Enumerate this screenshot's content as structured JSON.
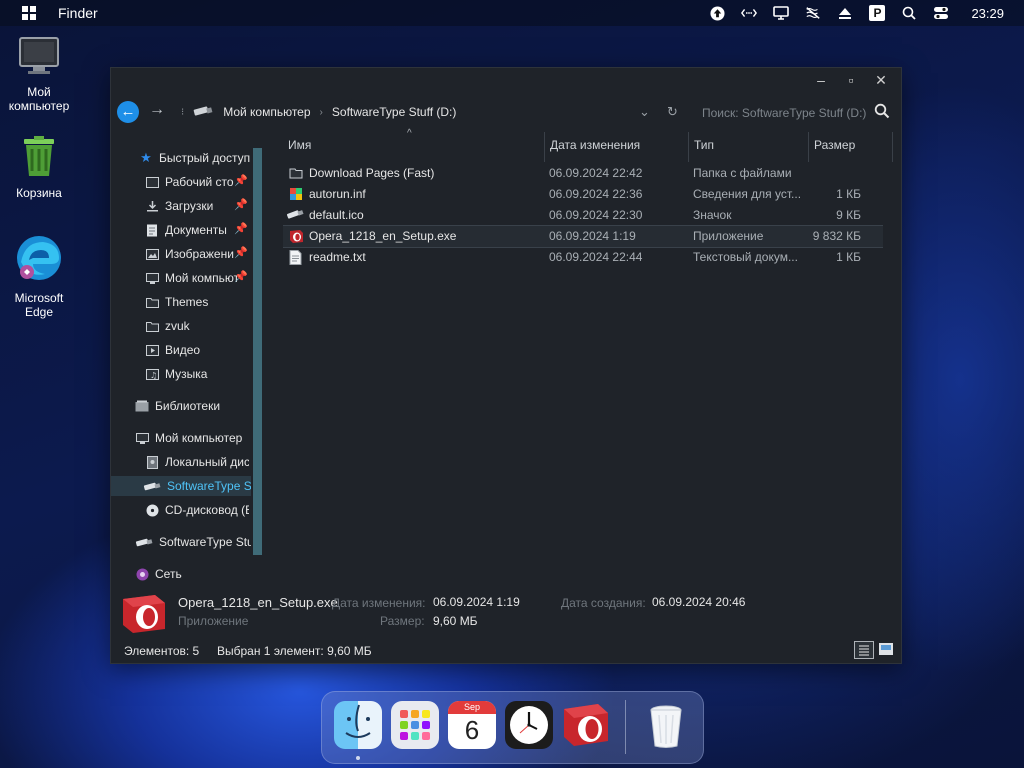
{
  "menubar": {
    "app_name": "Finder",
    "clock": "23:29",
    "tray_icons": [
      "upload-icon",
      "network-icon",
      "monitor-icon",
      "no-sound-icon",
      "eject-icon",
      "parking-icon",
      "search-icon",
      "toggle-icon"
    ],
    "parking_label": "P"
  },
  "desktop": {
    "icons": [
      {
        "label": "Мой компьютер",
        "icon": "computer-icon"
      },
      {
        "label": "Корзина",
        "icon": "recycle-bin-icon"
      },
      {
        "label": "Microsoft Edge",
        "icon": "edge-icon"
      }
    ]
  },
  "window": {
    "controls": {
      "minimize": "–",
      "maximize": "▫",
      "close": "✕"
    },
    "address": {
      "crumbs": [
        "Мой компьютер",
        "SoftwareType Stuff (D:)"
      ],
      "search_placeholder": "Поиск: SoftwareType Stuff (D:)"
    },
    "sidebar": {
      "quick_access": "Быстрый доступ",
      "quick_items": [
        "Рабочий сто",
        "Загрузки",
        "Документы",
        "Изображени",
        "Мой компьют",
        "Themes",
        "zvuk",
        "Видео",
        "Музыка"
      ],
      "libraries": "Библиотеки",
      "computer": "Мой компьютер",
      "computer_items": [
        "Локальный дис",
        "SoftwareType Stuf",
        "CD-дисковод (E"
      ],
      "drive": "SoftwareType Stuf",
      "network": "Сеть"
    },
    "columns": {
      "name": "Имя",
      "date": "Дата изменения",
      "type": "Тип",
      "size": "Размер"
    },
    "files": [
      {
        "name": "Download Pages (Fast)",
        "date": "06.09.2024 22:42",
        "type": "Папка с файлами",
        "size": "",
        "icon": "folder-icon"
      },
      {
        "name": "autorun.inf",
        "date": "06.09.2024 22:36",
        "type": "Сведения для уст...",
        "size": "1 КБ",
        "icon": "setup-info-icon"
      },
      {
        "name": "default.ico",
        "date": "06.09.2024 22:30",
        "type": "Значок",
        "size": "9 КБ",
        "icon": "usb-drive-icon"
      },
      {
        "name": "Opera_1218_en_Setup.exe",
        "date": "06.09.2024 1:19",
        "type": "Приложение",
        "size": "9 832 КБ",
        "icon": "opera-icon",
        "selected": true
      },
      {
        "name": "readme.txt",
        "date": "06.09.2024 22:44",
        "type": "Текстовый докум...",
        "size": "1 КБ",
        "icon": "text-file-icon"
      }
    ],
    "details": {
      "filename": "Opera_1218_en_Setup.exe",
      "type": "Приложение",
      "modified_label": "Дата изменения:",
      "modified": "06.09.2024 1:19",
      "size_label": "Размер:",
      "size": "9,60 МБ",
      "created_label": "Дата создания:",
      "created": "06.09.2024 20:46"
    },
    "status": {
      "count": "Элементов: 5",
      "selection": "Выбран 1 элемент: 9,60 МБ"
    }
  },
  "dock": {
    "items": [
      "finder-icon",
      "launchpad-icon",
      "calendar-icon",
      "clock-icon",
      "opera-icon",
      "trash-icon"
    ],
    "calendar_month": "Sep",
    "calendar_day": "6"
  }
}
